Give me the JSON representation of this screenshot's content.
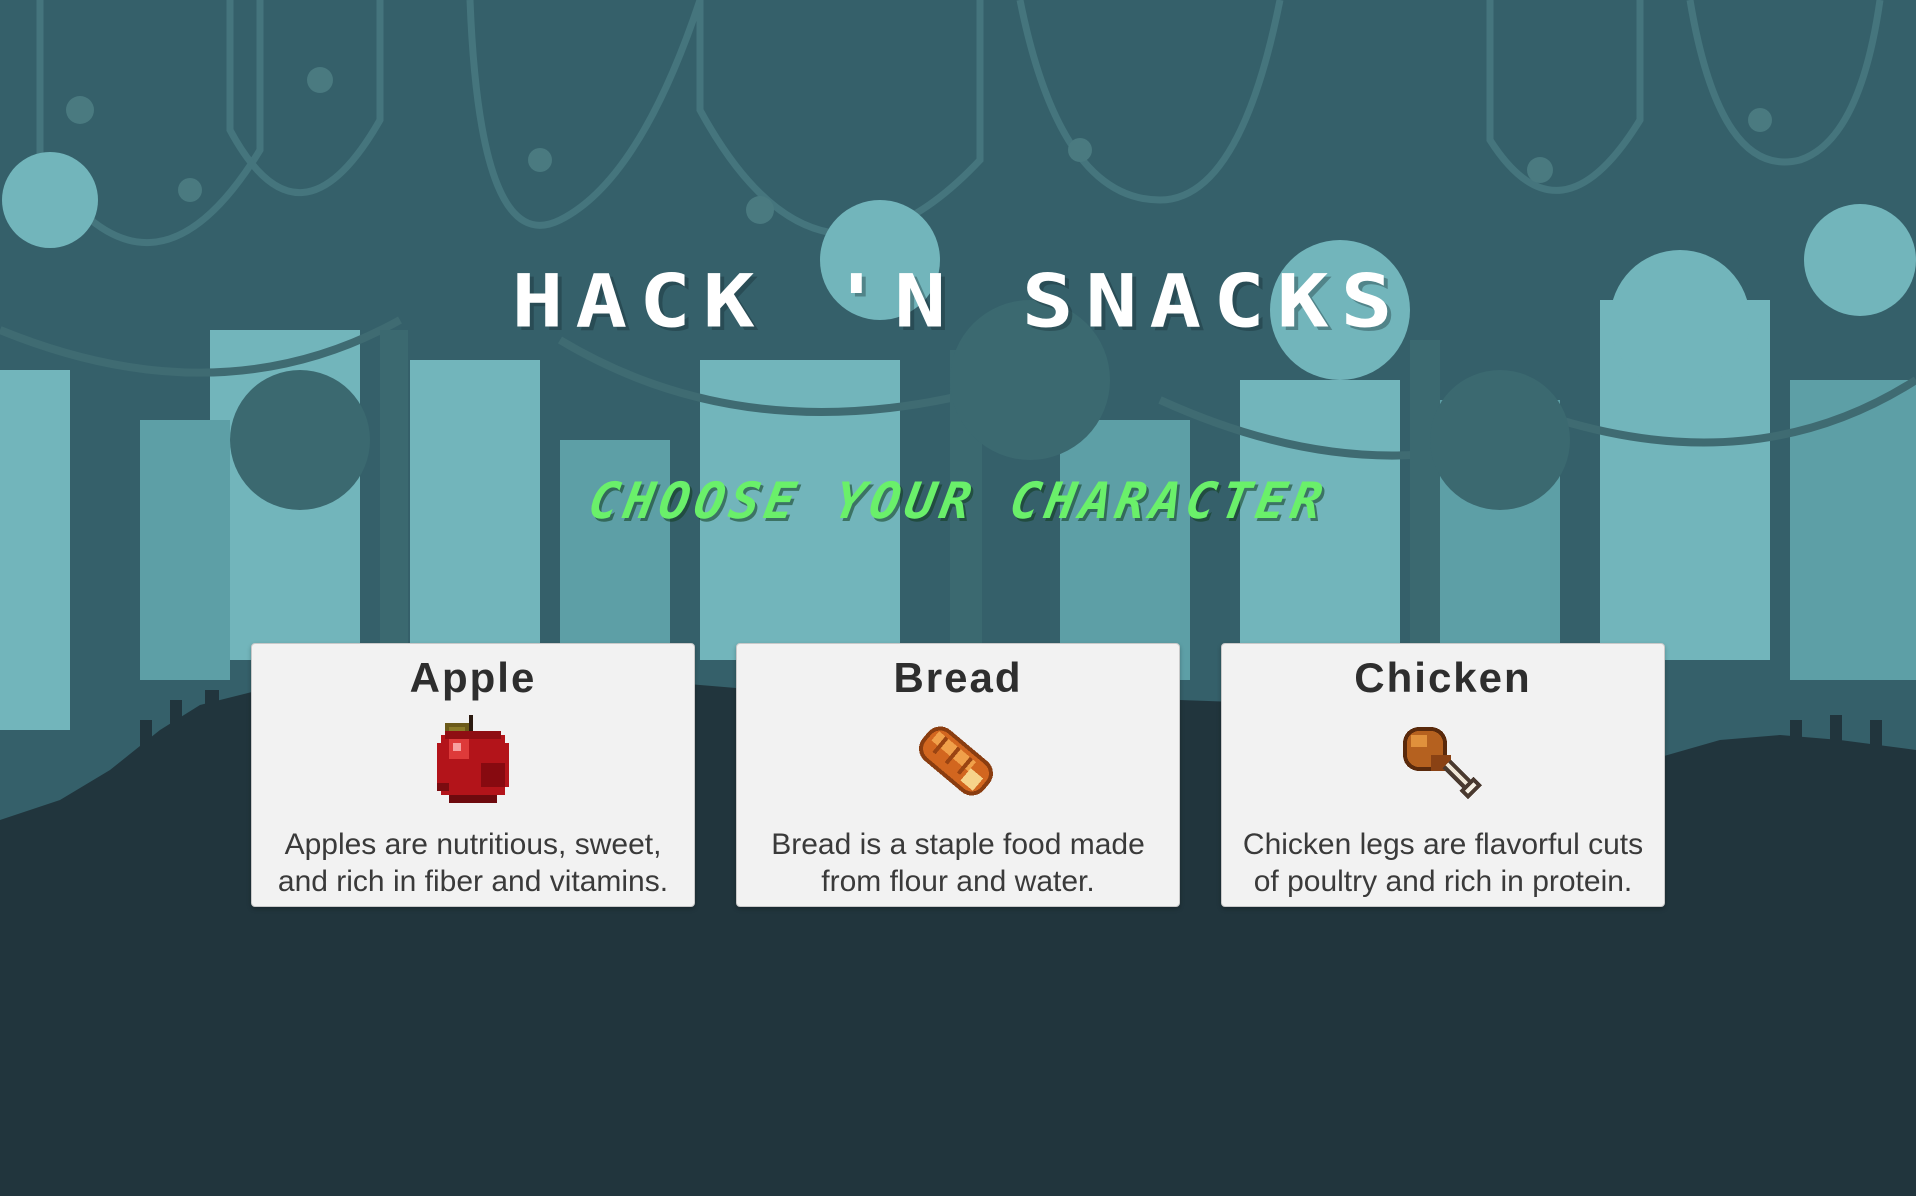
{
  "game": {
    "title": "HACK 'N SNACKS",
    "subtitle": "CHOOSE YOUR CHARACTER"
  },
  "characters": [
    {
      "name": "Apple",
      "icon": "apple-icon",
      "description": "Apples are nutritious, sweet, and rich in fiber and vitamins."
    },
    {
      "name": "Bread",
      "icon": "bread-icon",
      "description": "Bread is a staple food made from flour and water."
    },
    {
      "name": "Chicken",
      "icon": "chicken-leg-icon",
      "description": "Chicken legs are flavorful cuts of poultry and rich in protein."
    }
  ],
  "colors": {
    "sky": "#35606a",
    "ground": "#21353d",
    "title": "#ffffff",
    "subtitle": "#6af06a",
    "card": "#f2f2f2"
  }
}
